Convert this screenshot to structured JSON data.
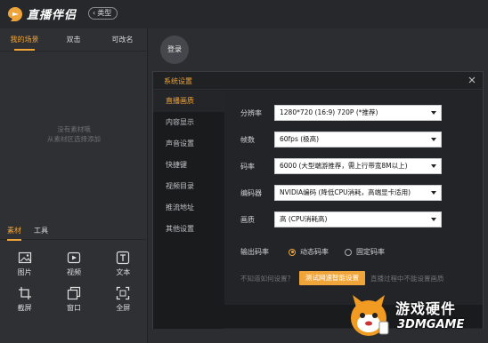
{
  "app": {
    "name": "直播伴侣",
    "mode_button": "类型"
  },
  "left": {
    "scene_tabs": [
      "我的场景",
      "双击",
      "可改名"
    ],
    "empty_hint_line1": "没有素材哦",
    "empty_hint_line2": "从素材区选择添加",
    "source_tabs": [
      "素材",
      "工具"
    ],
    "sources": [
      {
        "label": "图片",
        "icon": "image-icon"
      },
      {
        "label": "视频",
        "icon": "video-icon"
      },
      {
        "label": "文本",
        "icon": "text-icon"
      },
      {
        "label": "截屏",
        "icon": "crop-icon"
      },
      {
        "label": "窗口",
        "icon": "window-icon"
      },
      {
        "label": "全屏",
        "icon": "fullscreen-icon"
      }
    ]
  },
  "main": {
    "login": "登录"
  },
  "dialog": {
    "title": "系统设置",
    "nav": [
      "直播画质",
      "内容显示",
      "声音设置",
      "快捷键",
      "视频目录",
      "推流地址",
      "其他设置"
    ],
    "fields": [
      {
        "label": "分辨率",
        "value": "1280*720 (16:9) 720P (*推荐)"
      },
      {
        "label": "帧数",
        "value": "60fps (极高)"
      },
      {
        "label": "码率",
        "value": "6000 (大型端游推荐，需上行带宽8M以上)"
      },
      {
        "label": "编码器",
        "value": "NVIDIA编码 (降低CPU消耗，高端显卡适用)"
      },
      {
        "label": "画质",
        "value": "高 (CPU消耗高)"
      }
    ],
    "bitrate_mode_label": "输出码率",
    "bitrate_modes": [
      "动态码率",
      "固定码率"
    ],
    "help_prefix": "不知道如何设置？",
    "test_button": "测试网速智能设置",
    "help_suffix": "直播过程中不能设置画质"
  },
  "watermark": {
    "cn": "游戏硬件",
    "en": "3DMGAME"
  },
  "colors": {
    "accent": "#f0a53b",
    "bg": "#2b2d31",
    "dialog": "#1f2123"
  }
}
